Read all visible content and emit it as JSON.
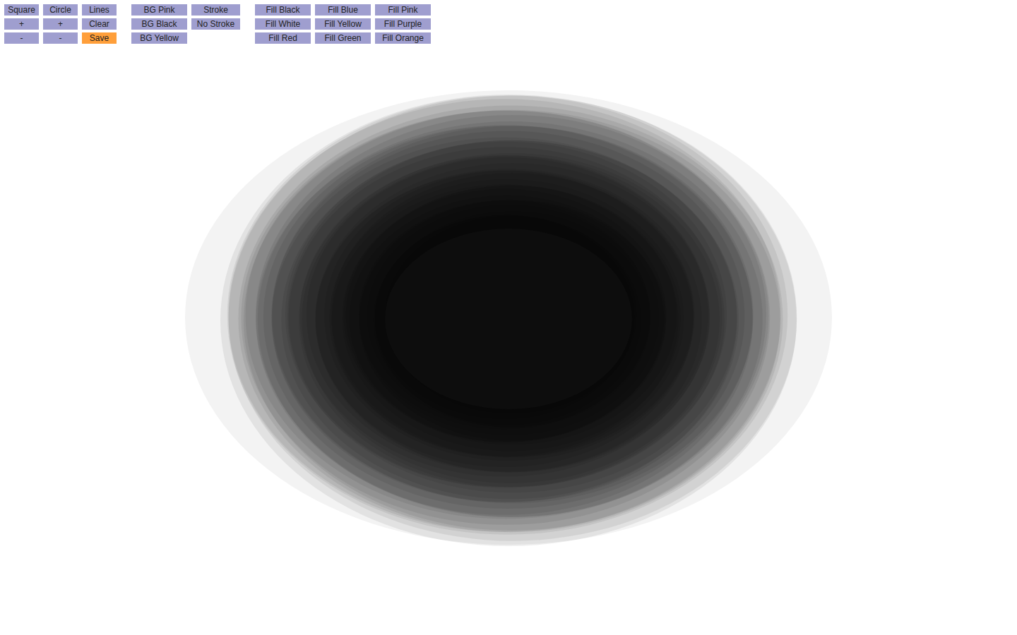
{
  "toolbar": {
    "groups": [
      {
        "columns": [
          {
            "buttons": [
              {
                "label": "Square",
                "highlighted": false
              },
              {
                "label": "+",
                "highlighted": false
              },
              {
                "label": "-",
                "highlighted": false
              }
            ]
          },
          {
            "buttons": [
              {
                "label": "Circle",
                "highlighted": false
              },
              {
                "label": "+",
                "highlighted": false
              },
              {
                "label": "-",
                "highlighted": false
              }
            ]
          },
          {
            "buttons": [
              {
                "label": "Lines",
                "highlighted": false
              },
              {
                "label": "Clear",
                "highlighted": false
              },
              {
                "label": "Save",
                "highlighted": true
              }
            ]
          }
        ]
      },
      {
        "columns": [
          {
            "buttons": [
              {
                "label": "BG Pink",
                "highlighted": false
              },
              {
                "label": "BG Black",
                "highlighted": false
              },
              {
                "label": "BG Yellow",
                "highlighted": false
              }
            ]
          },
          {
            "buttons": [
              {
                "label": "Stroke",
                "highlighted": false
              },
              {
                "label": "No Stroke",
                "highlighted": false
              }
            ]
          }
        ]
      },
      {
        "columns": [
          {
            "buttons": [
              {
                "label": "Fill Black",
                "highlighted": false
              },
              {
                "label": "Fill White",
                "highlighted": false
              },
              {
                "label": "Fill Red",
                "highlighted": false
              }
            ]
          },
          {
            "buttons": [
              {
                "label": "Fill Blue",
                "highlighted": false
              },
              {
                "label": "Fill Yellow",
                "highlighted": false
              },
              {
                "label": "Fill Green",
                "highlighted": false
              }
            ]
          },
          {
            "buttons": [
              {
                "label": "Fill Pink",
                "highlighted": false
              },
              {
                "label": "Fill Purple",
                "highlighted": false
              },
              {
                "label": "Fill Orange",
                "highlighted": false
              }
            ]
          }
        ]
      }
    ]
  }
}
